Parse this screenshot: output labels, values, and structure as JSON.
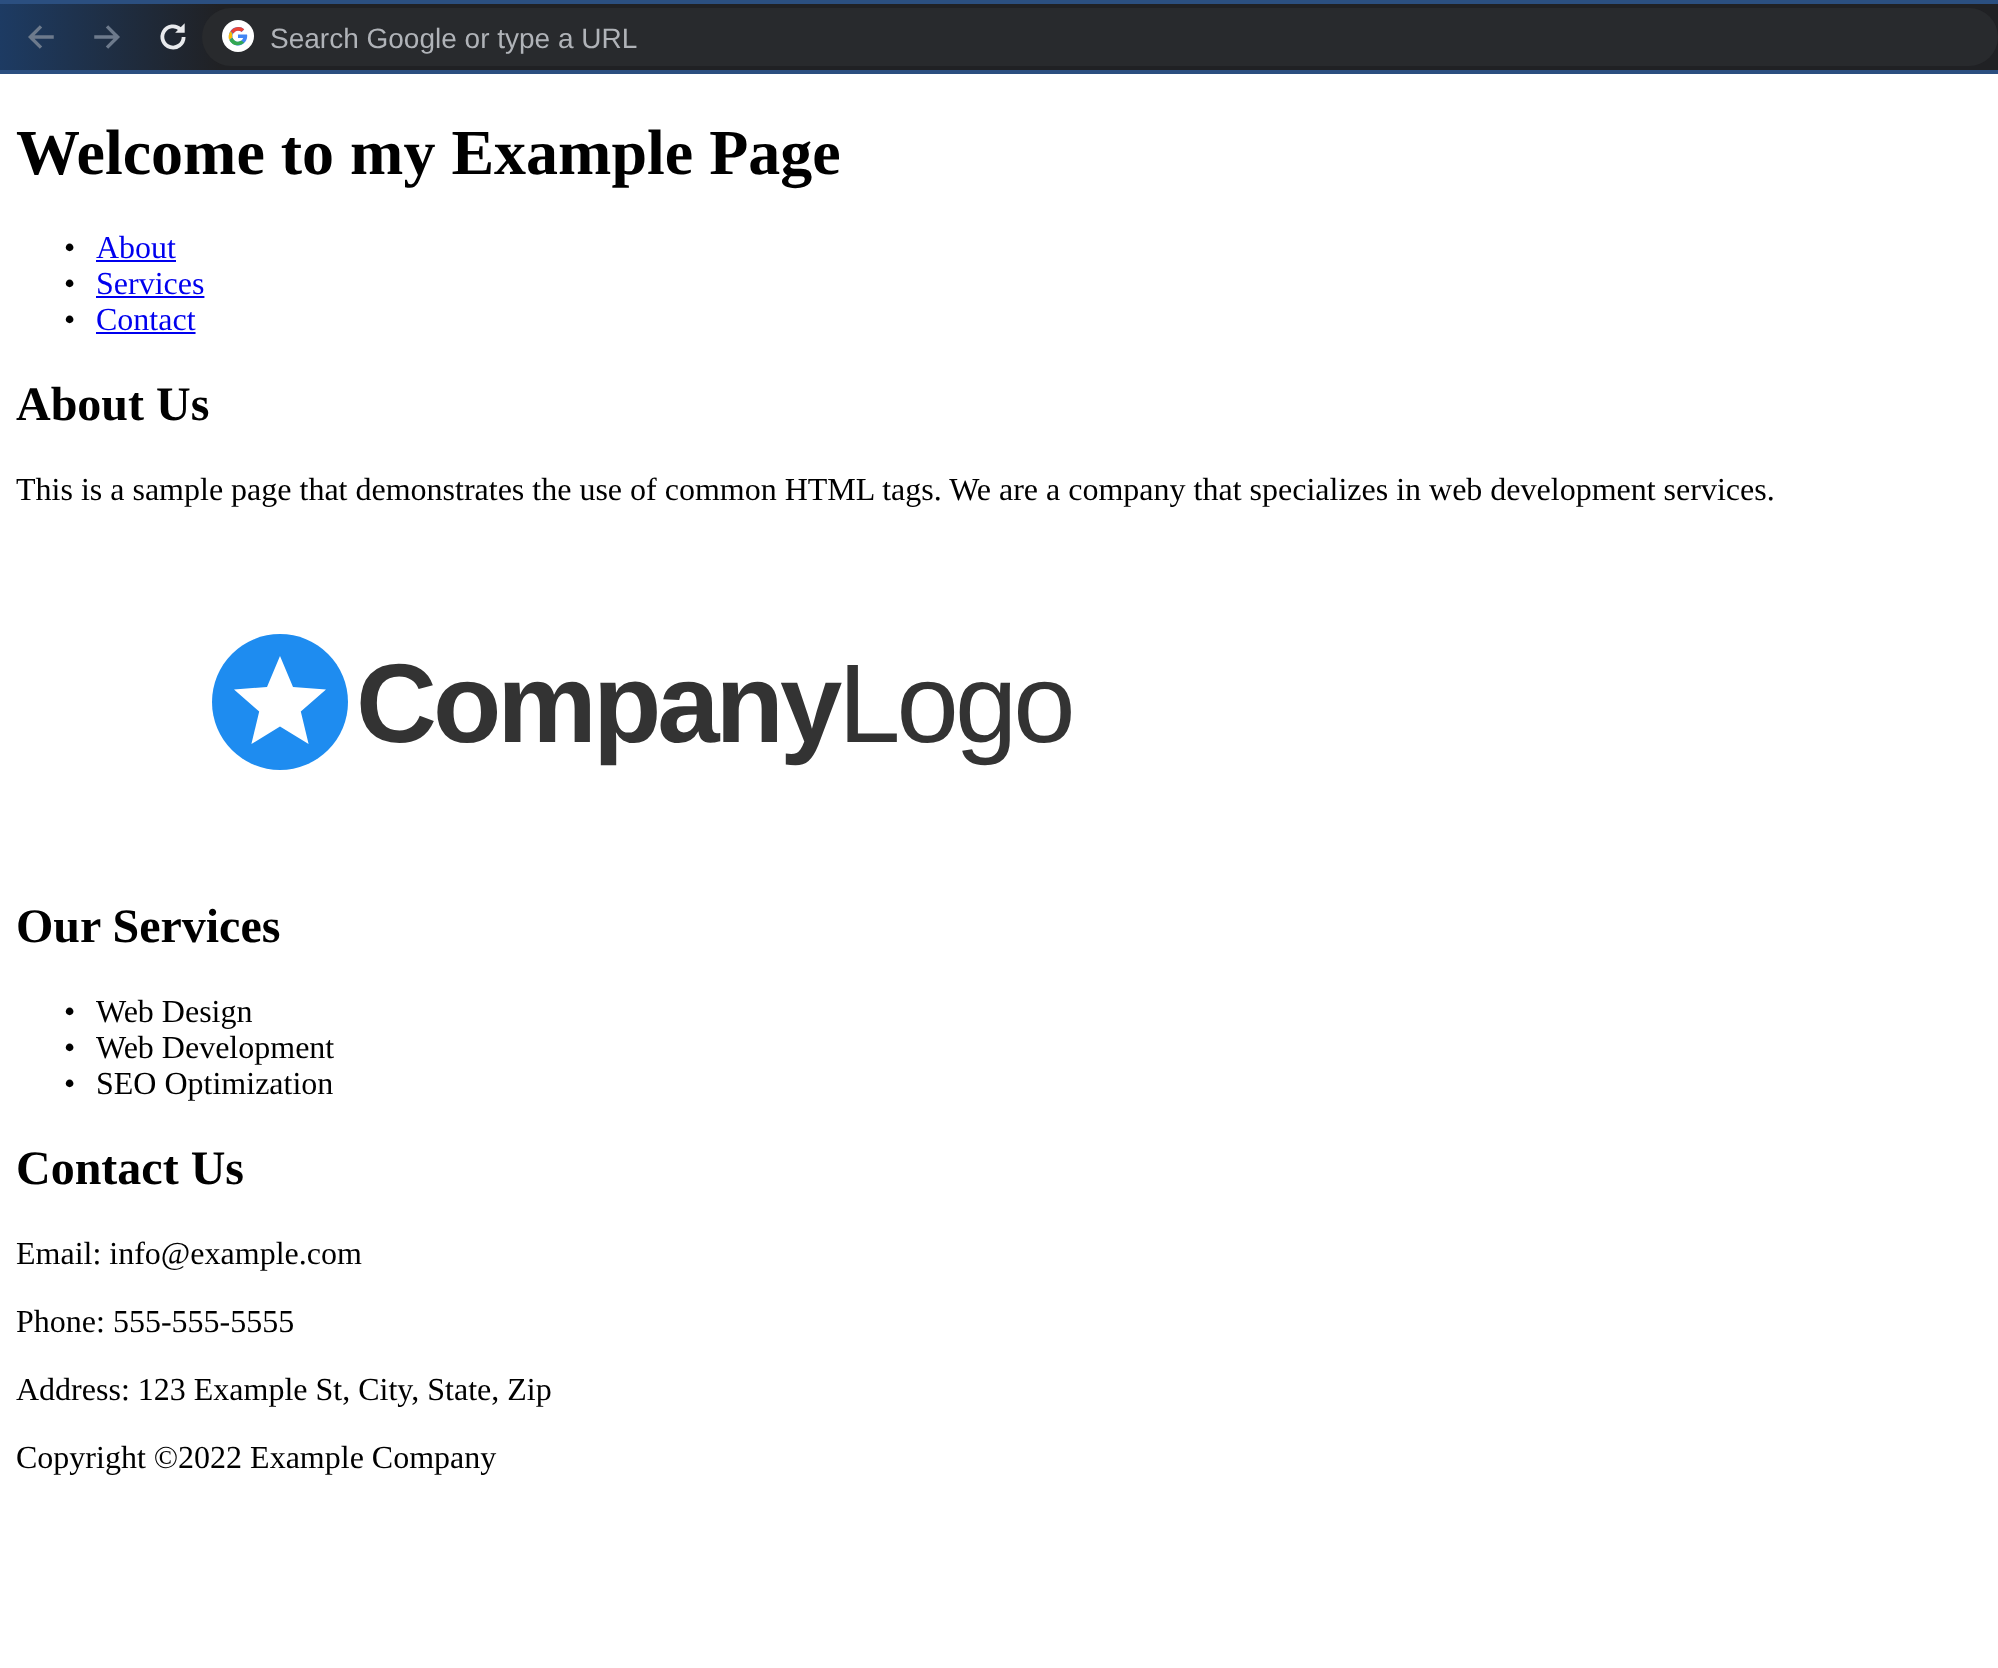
{
  "browser": {
    "back_disabled": true,
    "forward_disabled": true,
    "omnibox": {
      "placeholder": "Search Google or type a URL"
    }
  },
  "title": "Welcome to my Example Page",
  "nav": [
    {
      "marker": "•",
      "label": "About"
    },
    {
      "marker": "•",
      "label": "Services"
    },
    {
      "marker": "•",
      "label": "Contact"
    }
  ],
  "about": {
    "heading": "About Us",
    "text": "This is a sample page that demonstrates the use of common HTML tags. We are a company that specializes in web development services.",
    "logo": "**Company**Logo"
  },
  "services": {
    "heading": "Our Services",
    "items": [
      {
        "marker": "•",
        "label": "Web Design"
      },
      {
        "marker": "•",
        "label": "Web Development"
      },
      {
        "marker": "•",
        "label": "SEO Optimization"
      }
    ]
  },
  "contact": {
    "heading": "Contact Us",
    "lines": [
      "Email: info@example.com",
      "Phone: 555-555-5555",
      "Address: 123 Example St, City, State, Zip"
    ]
  },
  "footer": "Copyright ©2022 Example Company"
}
